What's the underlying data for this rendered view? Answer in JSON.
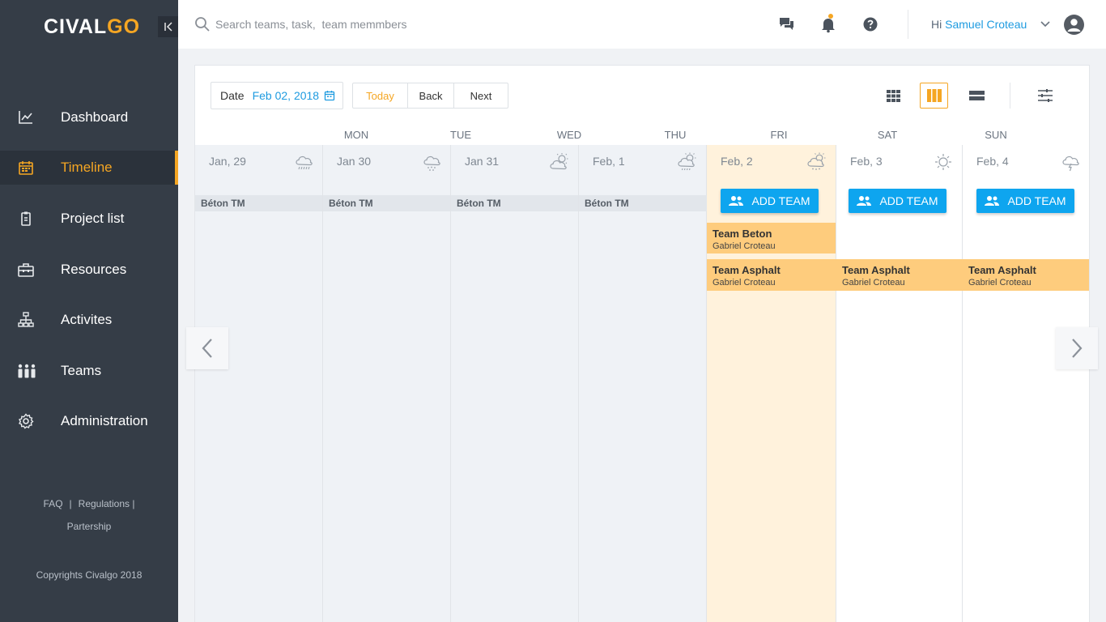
{
  "brand": {
    "logo_main": "CIVAL",
    "logo_accent": "GO"
  },
  "sidebar": {
    "collapse_label": "|<",
    "items": [
      {
        "label": "Dashboard",
        "icon": "chart-icon"
      },
      {
        "label": "Timeline",
        "icon": "calendar-icon",
        "active": true
      },
      {
        "label": "Project list",
        "icon": "clipboard-icon"
      },
      {
        "label": "Resources",
        "icon": "toolbox-icon"
      },
      {
        "label": "Activites",
        "icon": "hierarchy-icon"
      },
      {
        "label": "Teams",
        "icon": "people-icon"
      },
      {
        "label": "Administration",
        "icon": "gear-icon"
      }
    ],
    "footer": {
      "faq": "FAQ",
      "sep1": "|",
      "regulations": "Regulations |",
      "partnership": "Partership"
    },
    "copyright": "Copyrights Civalgo 2018"
  },
  "topbar": {
    "search_placeholder": "Search teams, task,  team memmbers",
    "greeting": "Hi",
    "user_name": "Samuel Croteau"
  },
  "toolbar": {
    "date_label": "Date",
    "date_value": "Feb 02, 2018",
    "today": "Today",
    "back": "Back",
    "next": "Next"
  },
  "weekdays": [
    "MON",
    "TUE",
    "WED",
    "THU",
    "FRI",
    "SAT",
    "SUN"
  ],
  "columns": [
    {
      "date": "Jan, 29",
      "weather": "rain",
      "label": "Béton TM"
    },
    {
      "date": "Jan  30",
      "weather": "snow",
      "label": "Béton TM"
    },
    {
      "date": "Jan  31",
      "weather": "partly-cloudy",
      "label": "Béton TM"
    },
    {
      "date": "Feb, 1",
      "weather": "sun-rain",
      "label": "Béton TM"
    },
    {
      "date": "Feb, 2",
      "weather": "sun-snow"
    },
    {
      "date": "Feb, 3",
      "weather": "sunny"
    },
    {
      "date": "Feb, 4",
      "weather": "thunder"
    }
  ],
  "add_team_label": "ADD TEAM",
  "teams": {
    "beton": {
      "name": "Team Beton",
      "member": "Gabriel Croteau"
    },
    "asphalt_fri": {
      "name": "Team Asphalt",
      "member": "Gabriel Croteau"
    },
    "asphalt_sat": {
      "name": "Team Asphalt",
      "member": "Gabriel Croteau"
    },
    "asphalt_sun": {
      "name": "Team Asphalt",
      "member": "Gabriel Croteau"
    }
  },
  "colors": {
    "accent": "#f5a623",
    "primary": "#0ea5ef",
    "sidebar": "#353d47",
    "team": "#fecc7d",
    "today_bg": "#fff2dc"
  }
}
